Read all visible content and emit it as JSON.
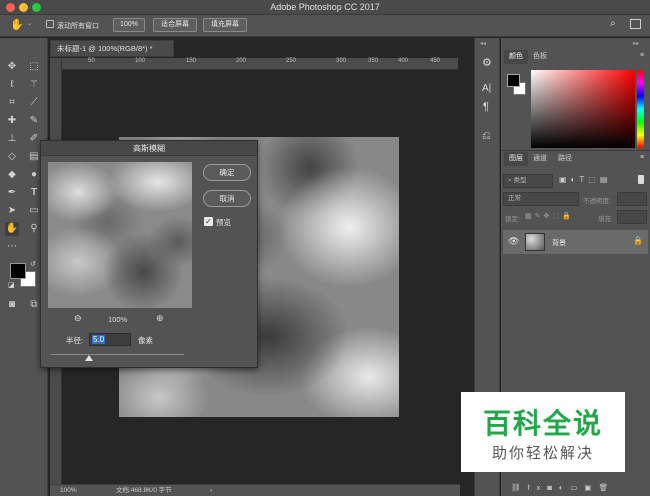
{
  "window": {
    "title": "Adobe Photoshop CC 2017"
  },
  "options_bar": {
    "scroll_all_windows": "滚动所有窗口",
    "zoom_100": "100%",
    "fit_screen": "适合屏幕",
    "fill_screen": "填充屏幕"
  },
  "document": {
    "tab_title": "未标题-1 @ 100%(RGB/8*) *",
    "ruler_ticks": [
      "50",
      "100",
      "150",
      "200",
      "250",
      "300",
      "350",
      "400",
      "450"
    ]
  },
  "status": {
    "zoom": "100%",
    "doc_info": "文档:468.8K/0 字节"
  },
  "dialog": {
    "title": "高斯模糊",
    "ok_label": "确定",
    "cancel_label": "取消",
    "preview_label": "预览",
    "preview_checked": true,
    "zoom_level": "100%",
    "radius_label": "半径:",
    "radius_value": "5.0",
    "radius_unit": "像素"
  },
  "color_panel": {
    "tabs": [
      "颜色",
      "色板"
    ],
    "foreground": "#000000",
    "background": "#ffffff"
  },
  "layers_panel": {
    "tabs": [
      "图层",
      "通道",
      "路径"
    ],
    "filter_label": "类型",
    "blend_mode": "正常",
    "opacity_label": "不透明度:",
    "lock_label": "锁定:",
    "fill_label": "填充:",
    "layers": [
      {
        "name": "背景",
        "locked": true,
        "visible": true
      }
    ]
  },
  "watermark": {
    "title": "百科全说",
    "subtitle": "助你轻松解决"
  }
}
